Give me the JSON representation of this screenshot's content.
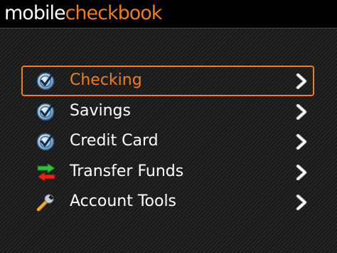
{
  "app": {
    "title_part1": "mobile",
    "title_part2": "checkbook",
    "brand_color": "#f07d1a"
  },
  "menu": {
    "items": [
      {
        "label": "Checking",
        "icon": "check-badge-icon",
        "selected": true
      },
      {
        "label": "Savings",
        "icon": "check-badge-icon",
        "selected": false
      },
      {
        "label": "Credit Card",
        "icon": "check-badge-icon",
        "selected": false
      },
      {
        "label": "Transfer Funds",
        "icon": "transfer-arrows-icon",
        "selected": false
      },
      {
        "label": "Account Tools",
        "icon": "wrench-icon",
        "selected": false
      }
    ]
  }
}
